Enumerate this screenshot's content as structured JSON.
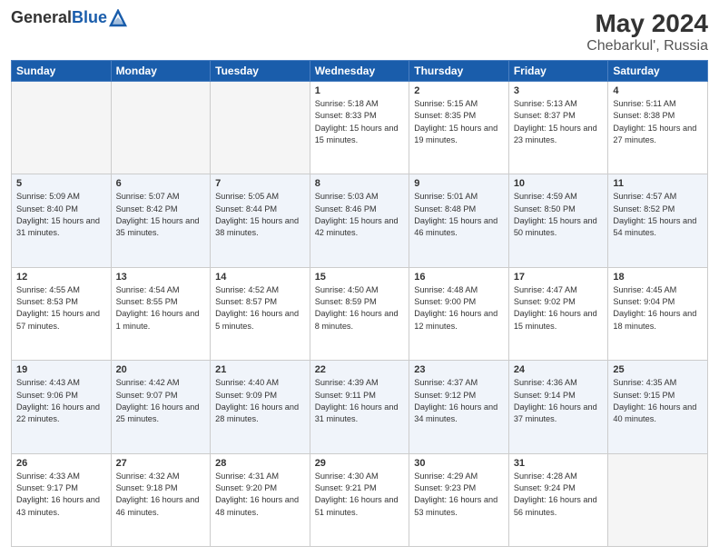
{
  "header": {
    "logo_general": "General",
    "logo_blue": "Blue",
    "month_title": "May 2024",
    "location": "Chebarkul', Russia"
  },
  "days_of_week": [
    "Sunday",
    "Monday",
    "Tuesday",
    "Wednesday",
    "Thursday",
    "Friday",
    "Saturday"
  ],
  "weeks": [
    {
      "days": [
        {
          "number": "",
          "info": ""
        },
        {
          "number": "",
          "info": ""
        },
        {
          "number": "",
          "info": ""
        },
        {
          "number": "1",
          "info": "Sunrise: 5:18 AM\nSunset: 8:33 PM\nDaylight: 15 hours\nand 15 minutes."
        },
        {
          "number": "2",
          "info": "Sunrise: 5:15 AM\nSunset: 8:35 PM\nDaylight: 15 hours\nand 19 minutes."
        },
        {
          "number": "3",
          "info": "Sunrise: 5:13 AM\nSunset: 8:37 PM\nDaylight: 15 hours\nand 23 minutes."
        },
        {
          "number": "4",
          "info": "Sunrise: 5:11 AM\nSunset: 8:38 PM\nDaylight: 15 hours\nand 27 minutes."
        }
      ]
    },
    {
      "days": [
        {
          "number": "5",
          "info": "Sunrise: 5:09 AM\nSunset: 8:40 PM\nDaylight: 15 hours\nand 31 minutes."
        },
        {
          "number": "6",
          "info": "Sunrise: 5:07 AM\nSunset: 8:42 PM\nDaylight: 15 hours\nand 35 minutes."
        },
        {
          "number": "7",
          "info": "Sunrise: 5:05 AM\nSunset: 8:44 PM\nDaylight: 15 hours\nand 38 minutes."
        },
        {
          "number": "8",
          "info": "Sunrise: 5:03 AM\nSunset: 8:46 PM\nDaylight: 15 hours\nand 42 minutes."
        },
        {
          "number": "9",
          "info": "Sunrise: 5:01 AM\nSunset: 8:48 PM\nDaylight: 15 hours\nand 46 minutes."
        },
        {
          "number": "10",
          "info": "Sunrise: 4:59 AM\nSunset: 8:50 PM\nDaylight: 15 hours\nand 50 minutes."
        },
        {
          "number": "11",
          "info": "Sunrise: 4:57 AM\nSunset: 8:52 PM\nDaylight: 15 hours\nand 54 minutes."
        }
      ]
    },
    {
      "days": [
        {
          "number": "12",
          "info": "Sunrise: 4:55 AM\nSunset: 8:53 PM\nDaylight: 15 hours\nand 57 minutes."
        },
        {
          "number": "13",
          "info": "Sunrise: 4:54 AM\nSunset: 8:55 PM\nDaylight: 16 hours\nand 1 minute."
        },
        {
          "number": "14",
          "info": "Sunrise: 4:52 AM\nSunset: 8:57 PM\nDaylight: 16 hours\nand 5 minutes."
        },
        {
          "number": "15",
          "info": "Sunrise: 4:50 AM\nSunset: 8:59 PM\nDaylight: 16 hours\nand 8 minutes."
        },
        {
          "number": "16",
          "info": "Sunrise: 4:48 AM\nSunset: 9:00 PM\nDaylight: 16 hours\nand 12 minutes."
        },
        {
          "number": "17",
          "info": "Sunrise: 4:47 AM\nSunset: 9:02 PM\nDaylight: 16 hours\nand 15 minutes."
        },
        {
          "number": "18",
          "info": "Sunrise: 4:45 AM\nSunset: 9:04 PM\nDaylight: 16 hours\nand 18 minutes."
        }
      ]
    },
    {
      "days": [
        {
          "number": "19",
          "info": "Sunrise: 4:43 AM\nSunset: 9:06 PM\nDaylight: 16 hours\nand 22 minutes."
        },
        {
          "number": "20",
          "info": "Sunrise: 4:42 AM\nSunset: 9:07 PM\nDaylight: 16 hours\nand 25 minutes."
        },
        {
          "number": "21",
          "info": "Sunrise: 4:40 AM\nSunset: 9:09 PM\nDaylight: 16 hours\nand 28 minutes."
        },
        {
          "number": "22",
          "info": "Sunrise: 4:39 AM\nSunset: 9:11 PM\nDaylight: 16 hours\nand 31 minutes."
        },
        {
          "number": "23",
          "info": "Sunrise: 4:37 AM\nSunset: 9:12 PM\nDaylight: 16 hours\nand 34 minutes."
        },
        {
          "number": "24",
          "info": "Sunrise: 4:36 AM\nSunset: 9:14 PM\nDaylight: 16 hours\nand 37 minutes."
        },
        {
          "number": "25",
          "info": "Sunrise: 4:35 AM\nSunset: 9:15 PM\nDaylight: 16 hours\nand 40 minutes."
        }
      ]
    },
    {
      "days": [
        {
          "number": "26",
          "info": "Sunrise: 4:33 AM\nSunset: 9:17 PM\nDaylight: 16 hours\nand 43 minutes."
        },
        {
          "number": "27",
          "info": "Sunrise: 4:32 AM\nSunset: 9:18 PM\nDaylight: 16 hours\nand 46 minutes."
        },
        {
          "number": "28",
          "info": "Sunrise: 4:31 AM\nSunset: 9:20 PM\nDaylight: 16 hours\nand 48 minutes."
        },
        {
          "number": "29",
          "info": "Sunrise: 4:30 AM\nSunset: 9:21 PM\nDaylight: 16 hours\nand 51 minutes."
        },
        {
          "number": "30",
          "info": "Sunrise: 4:29 AM\nSunset: 9:23 PM\nDaylight: 16 hours\nand 53 minutes."
        },
        {
          "number": "31",
          "info": "Sunrise: 4:28 AM\nSunset: 9:24 PM\nDaylight: 16 hours\nand 56 minutes."
        },
        {
          "number": "",
          "info": ""
        }
      ]
    }
  ]
}
